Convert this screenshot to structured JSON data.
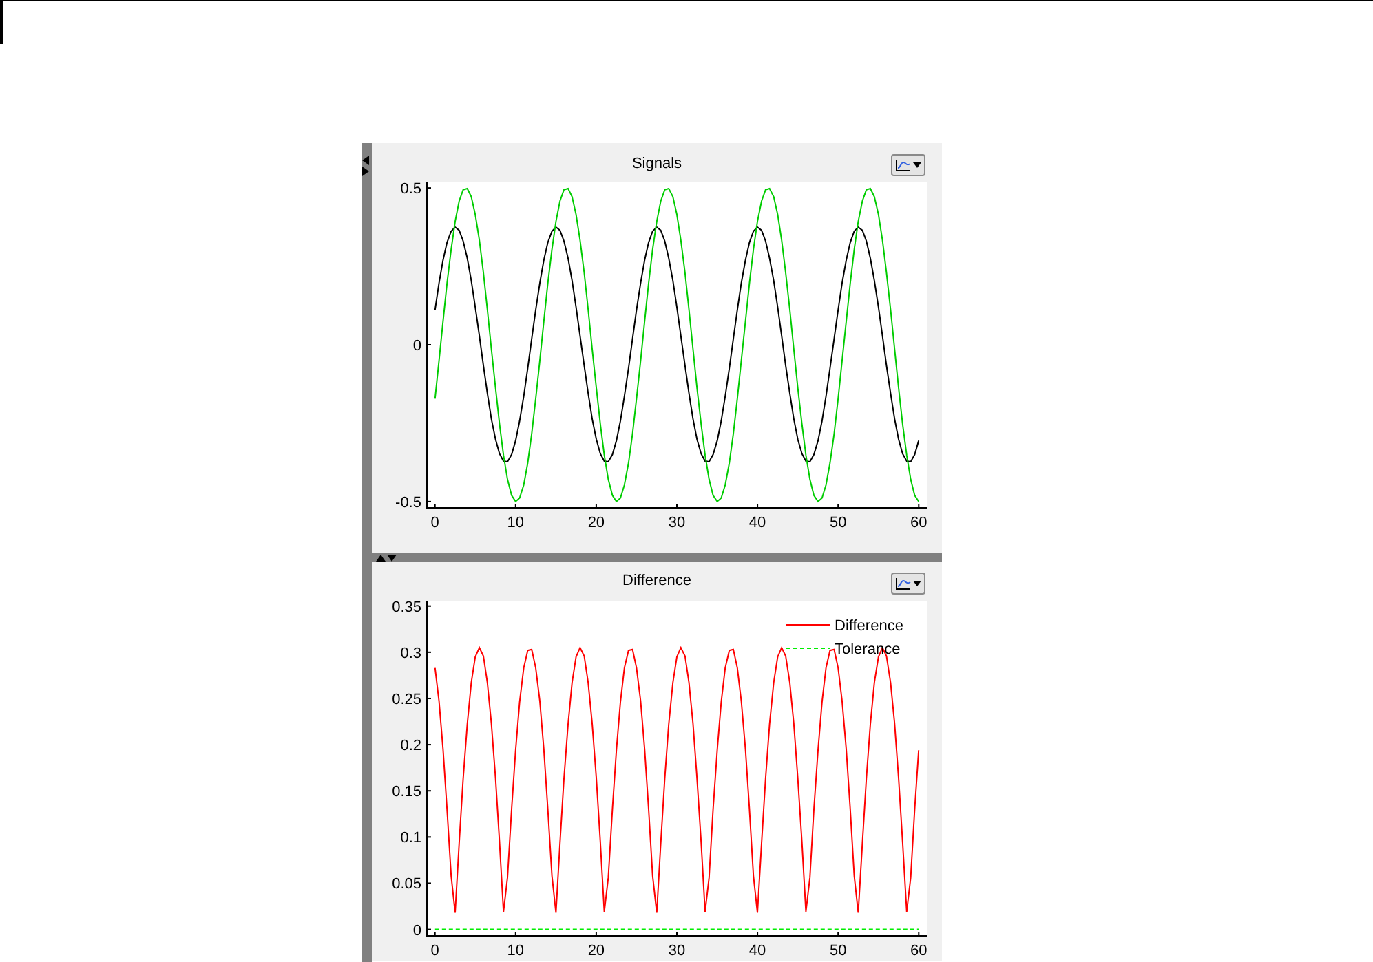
{
  "panels": [
    {
      "title": "Signals",
      "chart_data": {
        "type": "line",
        "xlim": [
          -1,
          61
        ],
        "ylim": [
          -0.52,
          0.52
        ],
        "xticks": [
          0,
          10,
          20,
          30,
          40,
          50,
          60
        ],
        "yticks": [
          -0.5,
          0,
          0.5
        ],
        "x": [
          0,
          0.5,
          1,
          1.5,
          2,
          2.5,
          3,
          3.5,
          4,
          4.5,
          5,
          5.5,
          6,
          6.5,
          7,
          7.5,
          8,
          8.5,
          9,
          9.5,
          10,
          10.5,
          11,
          11.5,
          12,
          12.5,
          13,
          13.5,
          14,
          14.5,
          15,
          15.5,
          16,
          16.5,
          17,
          17.5,
          18,
          18.5,
          19,
          19.5,
          20,
          20.5,
          21,
          21.5,
          22,
          22.5,
          23,
          23.5,
          24,
          24.5,
          25,
          25.5,
          26,
          26.5,
          27,
          27.5,
          28,
          28.5,
          29,
          29.5,
          30,
          30.5,
          31,
          31.5,
          32,
          32.5,
          33,
          33.5,
          34,
          34.5,
          35,
          35.5,
          36,
          36.5,
          37,
          37.5,
          38,
          38.5,
          39,
          39.5,
          40,
          40.5,
          41,
          41.5,
          42,
          42.5,
          43,
          43.5,
          44,
          44.5,
          45,
          45.5,
          46,
          46.5,
          47,
          47.5,
          48,
          48.5,
          49,
          49.5,
          50,
          50.5,
          51,
          51.5,
          52,
          52.5,
          53,
          53.5,
          54,
          54.5,
          55,
          55.5,
          56,
          56.5,
          57,
          57.5,
          58,
          58.5,
          59,
          59.5,
          60
        ],
        "series": [
          {
            "color": "#000000",
            "line_style": "solid",
            "values": [
              0.111,
              0.197,
              0.27,
              0.326,
              0.362,
              0.375,
              0.365,
              0.331,
              0.276,
              0.205,
              0.12,
              0.028,
              -0.066,
              -0.155,
              -0.236,
              -0.301,
              -0.347,
              -0.371,
              -0.373,
              -0.35,
              -0.306,
              -0.243,
              -0.164,
              -0.075,
              0.019,
              0.111,
              0.197,
              0.27,
              0.326,
              0.362,
              0.375,
              0.365,
              0.331,
              0.276,
              0.205,
              0.12,
              0.028,
              -0.066,
              -0.155,
              -0.236,
              -0.301,
              -0.347,
              -0.371,
              -0.373,
              -0.35,
              -0.306,
              -0.243,
              -0.164,
              -0.075,
              0.019,
              0.111,
              0.197,
              0.27,
              0.326,
              0.362,
              0.375,
              0.365,
              0.331,
              0.276,
              0.205,
              0.12,
              0.028,
              -0.066,
              -0.155,
              -0.236,
              -0.301,
              -0.347,
              -0.371,
              -0.373,
              -0.35,
              -0.306,
              -0.243,
              -0.164,
              -0.075,
              0.019,
              0.111,
              0.197,
              0.27,
              0.326,
              0.362,
              0.375,
              0.365,
              0.331,
              0.276,
              0.205,
              0.12,
              0.028,
              -0.066,
              -0.155,
              -0.236,
              -0.301,
              -0.347,
              -0.371,
              -0.373,
              -0.35,
              -0.306,
              -0.243,
              -0.164,
              -0.075,
              0.019,
              0.111,
              0.197,
              0.27,
              0.326,
              0.362,
              0.375,
              0.365,
              0.331,
              0.276,
              0.205,
              0.12,
              0.028,
              -0.066,
              -0.155,
              -0.236,
              -0.301,
              -0.347,
              -0.371,
              -0.373,
              -0.35,
              -0.306
            ]
          },
          {
            "color": "#00cc00",
            "line_style": "solid",
            "values": [
              -0.172,
              -0.05,
              0.075,
              0.196,
              0.304,
              0.393,
              0.458,
              0.494,
              0.498,
              0.472,
              0.415,
              0.333,
              0.23,
              0.112,
              -0.013,
              -0.137,
              -0.252,
              -0.352,
              -0.429,
              -0.48,
              -0.5,
              -0.489,
              -0.447,
              -0.377,
              -0.284,
              -0.172,
              -0.05,
              0.075,
              0.196,
              0.304,
              0.393,
              0.458,
              0.494,
              0.498,
              0.472,
              0.415,
              0.333,
              0.23,
              0.112,
              -0.013,
              -0.137,
              -0.252,
              -0.352,
              -0.429,
              -0.48,
              -0.5,
              -0.489,
              -0.447,
              -0.377,
              -0.284,
              -0.172,
              -0.05,
              0.075,
              0.196,
              0.304,
              0.393,
              0.458,
              0.494,
              0.498,
              0.472,
              0.415,
              0.333,
              0.23,
              0.112,
              -0.013,
              -0.137,
              -0.252,
              -0.352,
              -0.429,
              -0.48,
              -0.5,
              -0.489,
              -0.447,
              -0.377,
              -0.284,
              -0.172,
              -0.05,
              0.075,
              0.196,
              0.304,
              0.393,
              0.458,
              0.494,
              0.498,
              0.472,
              0.415,
              0.333,
              0.23,
              0.112,
              -0.013,
              -0.137,
              -0.252,
              -0.352,
              -0.429,
              -0.48,
              -0.5,
              -0.489,
              -0.447,
              -0.377,
              -0.284,
              -0.172,
              -0.05,
              0.075,
              0.196,
              0.304,
              0.393,
              0.458,
              0.494,
              0.498,
              0.472,
              0.415,
              0.333,
              0.23,
              0.112,
              -0.013,
              -0.137,
              -0.252,
              -0.352,
              -0.429,
              -0.48,
              -0.5
            ]
          }
        ]
      }
    },
    {
      "title": "Difference",
      "chart_data": {
        "type": "line",
        "legend": true,
        "xlim": [
          -1,
          61
        ],
        "ylim": [
          -0.007,
          0.355
        ],
        "xticks": [
          0,
          10,
          20,
          30,
          40,
          50,
          60
        ],
        "yticks": [
          0,
          0.05,
          0.1,
          0.15,
          0.2,
          0.25,
          0.3,
          0.35
        ],
        "x": [
          0,
          0.5,
          1,
          1.5,
          2,
          2.5,
          3,
          3.5,
          4,
          4.5,
          5,
          5.5,
          6,
          6.5,
          7,
          7.5,
          8,
          8.5,
          9,
          9.5,
          10,
          10.5,
          11,
          11.5,
          12,
          12.5,
          13,
          13.5,
          14,
          14.5,
          15,
          15.5,
          16,
          16.5,
          17,
          17.5,
          18,
          18.5,
          19,
          19.5,
          20,
          20.5,
          21,
          21.5,
          22,
          22.5,
          23,
          23.5,
          24,
          24.5,
          25,
          25.5,
          26,
          26.5,
          27,
          27.5,
          28,
          28.5,
          29,
          29.5,
          30,
          30.5,
          31,
          31.5,
          32,
          32.5,
          33,
          33.5,
          34,
          34.5,
          35,
          35.5,
          36,
          36.5,
          37,
          37.5,
          38,
          38.5,
          39,
          39.5,
          40,
          40.5,
          41,
          41.5,
          42,
          42.5,
          43,
          43.5,
          44,
          44.5,
          45,
          45.5,
          46,
          46.5,
          47,
          47.5,
          48,
          48.5,
          49,
          49.5,
          50,
          50.5,
          51,
          51.5,
          52,
          52.5,
          53,
          53.5,
          54,
          54.5,
          55,
          55.5,
          56,
          56.5,
          57,
          57.5,
          58,
          58.5,
          59,
          59.5,
          60
        ],
        "series": [
          {
            "name": "Difference",
            "color": "#ff0000",
            "line_style": "solid",
            "values": [
              0.283,
              0.247,
              0.195,
              0.13,
              0.058,
              0.018,
              0.093,
              0.163,
              0.222,
              0.267,
              0.295,
              0.305,
              0.296,
              0.267,
              0.223,
              0.164,
              0.095,
              0.019,
              0.056,
              0.13,
              0.194,
              0.246,
              0.283,
              0.302,
              0.303,
              0.283,
              0.247,
              0.195,
              0.13,
              0.058,
              0.018,
              0.093,
              0.163,
              0.222,
              0.267,
              0.295,
              0.305,
              0.296,
              0.267,
              0.223,
              0.164,
              0.095,
              0.019,
              0.056,
              0.13,
              0.194,
              0.246,
              0.283,
              0.302,
              0.303,
              0.283,
              0.247,
              0.195,
              0.13,
              0.058,
              0.018,
              0.093,
              0.163,
              0.222,
              0.267,
              0.295,
              0.305,
              0.296,
              0.267,
              0.223,
              0.164,
              0.095,
              0.019,
              0.056,
              0.13,
              0.194,
              0.246,
              0.283,
              0.302,
              0.303,
              0.283,
              0.247,
              0.195,
              0.13,
              0.058,
              0.018,
              0.093,
              0.163,
              0.222,
              0.267,
              0.295,
              0.305,
              0.296,
              0.267,
              0.223,
              0.164,
              0.095,
              0.019,
              0.056,
              0.13,
              0.194,
              0.246,
              0.283,
              0.302,
              0.303,
              0.283,
              0.247,
              0.195,
              0.13,
              0.058,
              0.018,
              0.093,
              0.163,
              0.222,
              0.267,
              0.295,
              0.305,
              0.296,
              0.267,
              0.223,
              0.164,
              0.095,
              0.019,
              0.056,
              0.13,
              0.194
            ]
          },
          {
            "name": "Tolerance",
            "color": "#00ee00",
            "line_style": "dashed",
            "values": [
              0,
              0,
              0,
              0,
              0,
              0,
              0,
              0,
              0,
              0,
              0,
              0,
              0,
              0,
              0,
              0,
              0,
              0,
              0,
              0,
              0,
              0,
              0,
              0,
              0,
              0,
              0,
              0,
              0,
              0,
              0,
              0,
              0,
              0,
              0,
              0,
              0,
              0,
              0,
              0,
              0,
              0,
              0,
              0,
              0,
              0,
              0,
              0,
              0,
              0,
              0,
              0,
              0,
              0,
              0,
              0,
              0,
              0,
              0,
              0,
              0,
              0,
              0,
              0,
              0,
              0,
              0,
              0,
              0,
              0,
              0,
              0,
              0,
              0,
              0,
              0,
              0,
              0,
              0,
              0,
              0,
              0,
              0,
              0,
              0,
              0,
              0,
              0,
              0,
              0,
              0,
              0,
              0,
              0,
              0,
              0,
              0,
              0,
              0,
              0,
              0,
              0,
              0,
              0,
              0,
              0,
              0,
              0,
              0,
              0,
              0,
              0,
              0,
              0,
              0,
              0,
              0,
              0,
              0,
              0,
              0
            ]
          }
        ]
      }
    }
  ]
}
